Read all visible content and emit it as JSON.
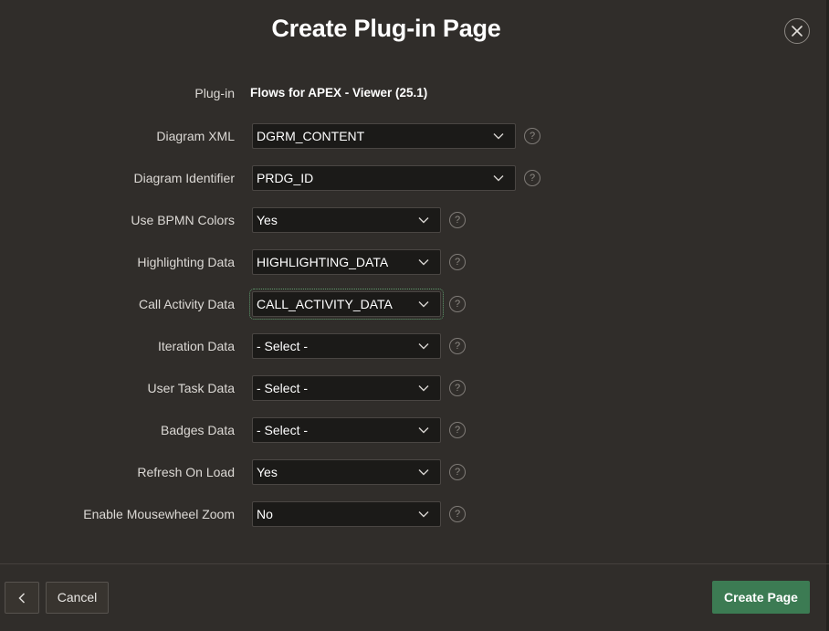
{
  "dialog": {
    "title": "Create Plug-in Page"
  },
  "icons": {
    "close": "close-icon",
    "chevron": "chevron-down-icon",
    "help": "help-icon",
    "back": "chevron-left-icon"
  },
  "plugin": {
    "label": "Plug-in",
    "value": "Flows for APEX - Viewer (25.1)"
  },
  "fields": [
    {
      "label": "Diagram XML",
      "value": "DGRM_CONTENT"
    },
    {
      "label": "Diagram Identifier",
      "value": "PRDG_ID"
    },
    {
      "label": "Use BPMN Colors",
      "value": "Yes"
    },
    {
      "label": "Highlighting Data",
      "value": "HIGHLIGHTING_DATA"
    },
    {
      "label": "Call Activity Data",
      "value": "CALL_ACTIVITY_DATA"
    },
    {
      "label": "Iteration Data",
      "value": "- Select -"
    },
    {
      "label": "User Task Data",
      "value": "- Select -"
    },
    {
      "label": "Badges Data",
      "value": "- Select -"
    },
    {
      "label": "Refresh On Load",
      "value": "Yes"
    },
    {
      "label": "Enable Mousewheel Zoom",
      "value": "No"
    }
  ],
  "help_glyph": "?",
  "footer": {
    "cancel_label": "Cancel",
    "create_label": "Create Page"
  },
  "colors": {
    "background": "#302d2a",
    "select_bg": "#1b1a18",
    "primary_button": "#3c7b53",
    "focus_outline": "#5e9a6d"
  }
}
